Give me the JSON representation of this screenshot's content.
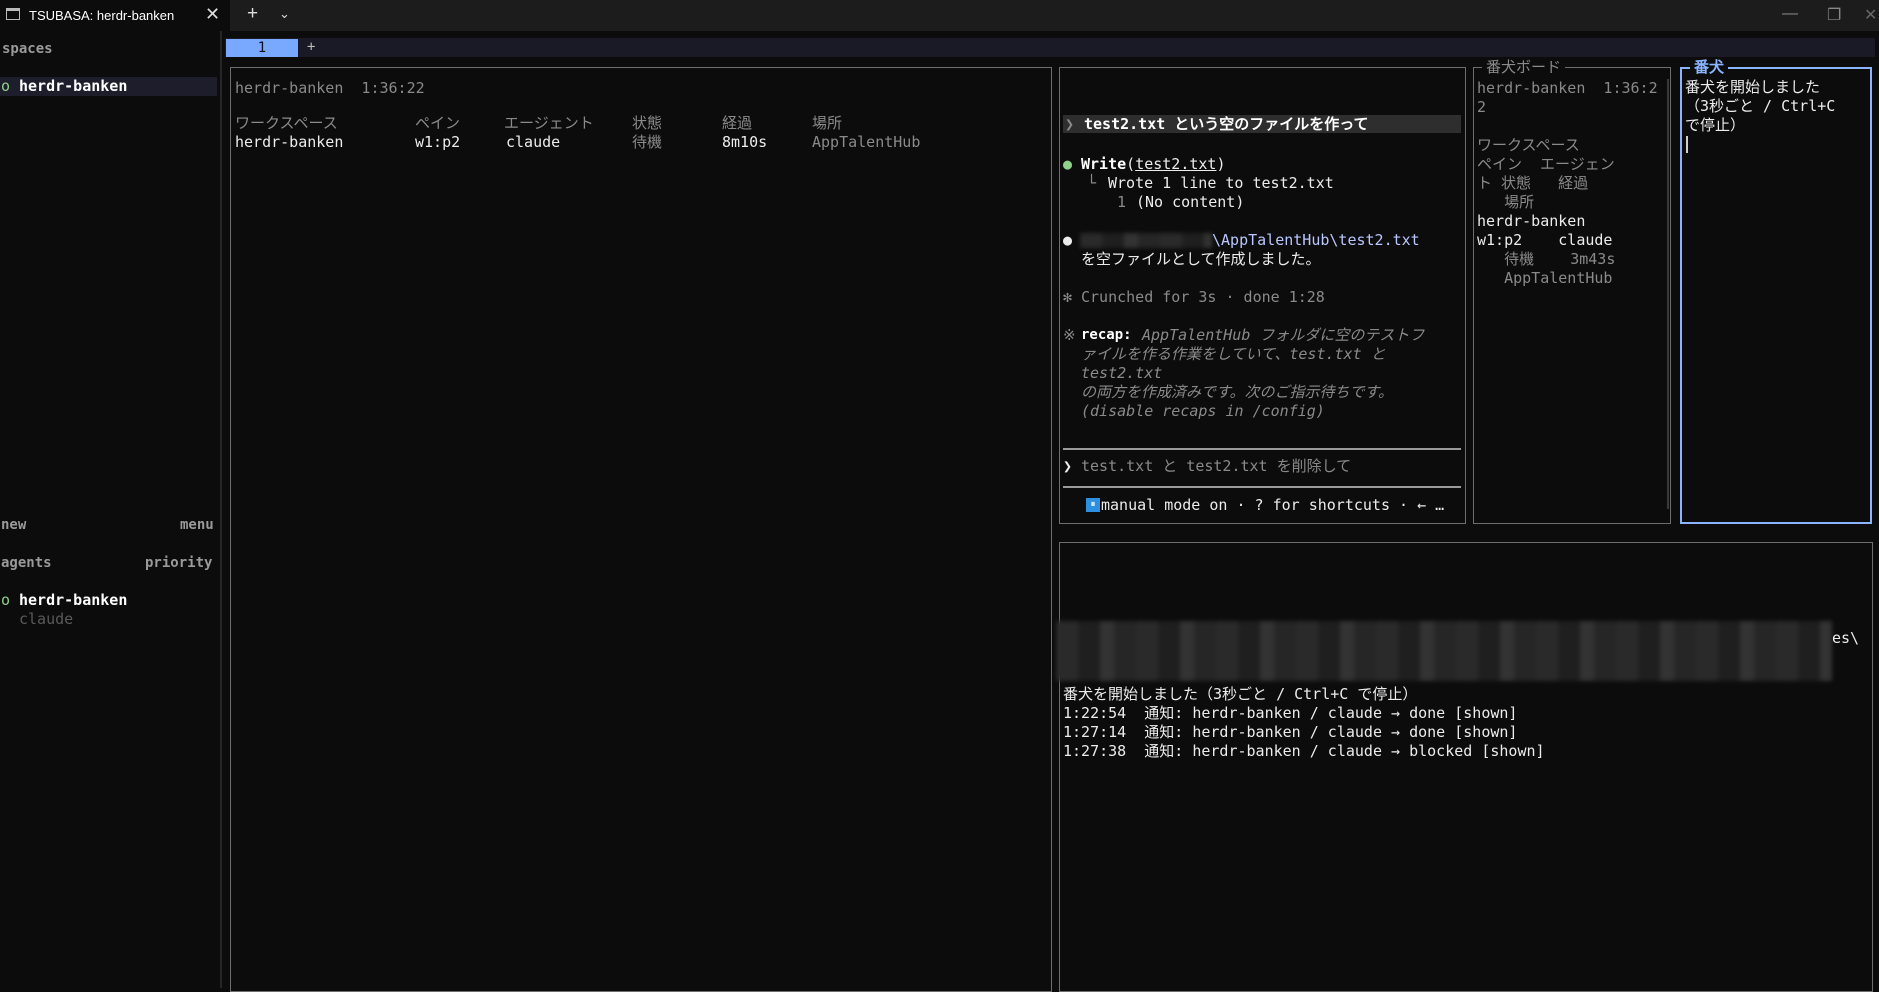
{
  "window": {
    "tab_title": "TSUBASA: herdr-banken",
    "close_glyph": "✕",
    "new_tab_glyph": "+",
    "dropdown_glyph": "⌄",
    "minimize_glyph": "—",
    "maximize_glyph": "❐",
    "window_close_glyph": "✕"
  },
  "sidebar": {
    "spaces_label": "spaces",
    "spaces": [
      {
        "indicator": "o",
        "name": "herdr-banken"
      }
    ],
    "new_label": "new",
    "menu_label": "menu",
    "agents_label": "agents",
    "priority_label": "priority",
    "agents": [
      {
        "indicator": "o",
        "name": "herdr-banken",
        "agent": "claude"
      }
    ]
  },
  "workspace_tabs": {
    "tabs": [
      "1"
    ],
    "add_glyph": "+"
  },
  "left_pane": {
    "header": "herdr-banken  1:36:22",
    "columns": [
      "ワークスペース",
      "ペイン",
      "エージェント",
      "状態",
      "経過",
      "場所"
    ],
    "rows": [
      {
        "workspace": "herdr-banken",
        "pane": "w1:p2",
        "agent": "claude",
        "state": "待機",
        "elapsed": "8m10s",
        "location": "AppTalentHub"
      }
    ]
  },
  "claude_pane": {
    "user_prompt_marker": "❯",
    "user_prompt": "test2.txt という空のファイルを作って",
    "tool_dot": "●",
    "tool_name": "Write",
    "tool_arg": "test2.txt",
    "tool_result_branch": "└",
    "tool_result": "Wrote 1 line to test2.txt",
    "tool_result_line_no": "1",
    "tool_result_content": "(No content)",
    "reply_dot": "●",
    "reply_path_visible": "\\AppTalentHub\\test2.txt",
    "reply_text": "を空ファイルとして作成しました。",
    "crunched_glyph": "✻",
    "crunched_text": "Crunched for 3s · done 1:28",
    "recap_glyph": "※",
    "recap_label": "recap:",
    "recap_lines": [
      "AppTalentHub フォルダに空のテストフ",
      "ァイルを作る作業をしていて、test.txt と",
      "test2.txt",
      "の両方を作成済みです。次のご指示待ちです。",
      "(disable recaps in /config)"
    ],
    "input_marker": "❯",
    "input_placeholder": "test.txt と test2.txt を削除して",
    "mode_icon": "⏸",
    "mode_text": "manual mode on · ? for shortcuts · ← …"
  },
  "board_pane": {
    "title": "番犬ボード",
    "lines": [
      "herdr-banken  1:36:2",
      "2",
      "",
      "ワークスペース",
      "ペイン  エージェン",
      "ト 状態   経過",
      "   場所",
      "herdr-banken",
      "w1:p2    claude",
      "   待機    3m43s",
      "   AppTalentHub"
    ]
  },
  "banken_pane": {
    "title": "番犬",
    "lines": [
      "番犬を開始しました",
      "（3秒ごと / Ctrl+C",
      "で停止）"
    ]
  },
  "log_pane": {
    "path_tail": "es\\",
    "lines": [
      "番犬を開始しました（3秒ごと / Ctrl+C で停止）",
      "1:22:54  通知: herdr-banken / claude → done [shown]",
      "1:27:14  通知: herdr-banken / claude → done [shown]",
      "1:27:38  通知: herdr-banken / claude → blocked [shown]"
    ]
  },
  "colors": {
    "accent": "#8ab4ff",
    "tab_active": "#79a9ff",
    "ok_dot": "#8fd18a",
    "background": "#0c0c0c"
  }
}
